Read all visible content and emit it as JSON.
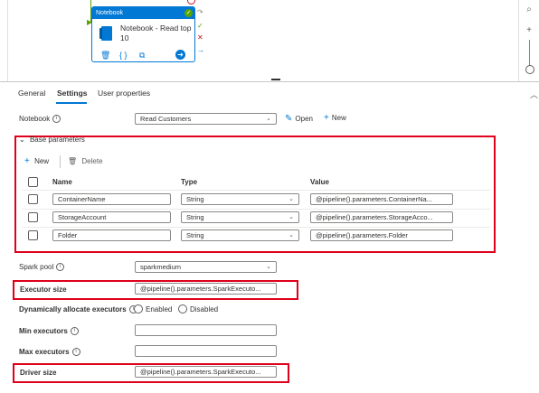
{
  "canvas": {
    "activity_type": "Notebook",
    "activity_name": "Notebook - Read top 10",
    "status_glyph": "✓"
  },
  "tabs": [
    {
      "label": "General"
    },
    {
      "label": "Settings"
    },
    {
      "label": "User properties"
    }
  ],
  "notebook": {
    "label": "Notebook",
    "selected": "Read Customers",
    "open_label": "Open",
    "new_label": "New"
  },
  "base_parameters": {
    "title": "Base parameters",
    "new_label": "New",
    "delete_label": "Delete",
    "columns": {
      "name": "Name",
      "type": "Type",
      "value": "Value"
    },
    "rows": [
      {
        "name": "ContainerName",
        "type": "String",
        "value": "@pipeline().parameters.ContainerNa..."
      },
      {
        "name": "StorageAccount",
        "type": "String",
        "value": "@pipeline().parameters.StorageAcco..."
      },
      {
        "name": "Folder",
        "type": "String",
        "value": "@pipeline().parameters.Folder"
      }
    ]
  },
  "spark_pool": {
    "label": "Spark pool",
    "selected": "sparkmedium"
  },
  "executor_size": {
    "label": "Executor size",
    "value": "@pipeline().parameters.SparkExecuto..."
  },
  "dynamic_alloc": {
    "label": "Dynamically allocate executors",
    "enabled": "Enabled",
    "disabled": "Disabled"
  },
  "min_executors": {
    "label": "Min executors",
    "value": ""
  },
  "max_executors": {
    "label": "Max executors",
    "value": ""
  },
  "driver_size": {
    "label": "Driver size",
    "value": "@pipeline().parameters.SparkExecuto..."
  },
  "colors": {
    "accent": "#0078d4",
    "highlight": "#e0001b",
    "success": "#57a300"
  }
}
